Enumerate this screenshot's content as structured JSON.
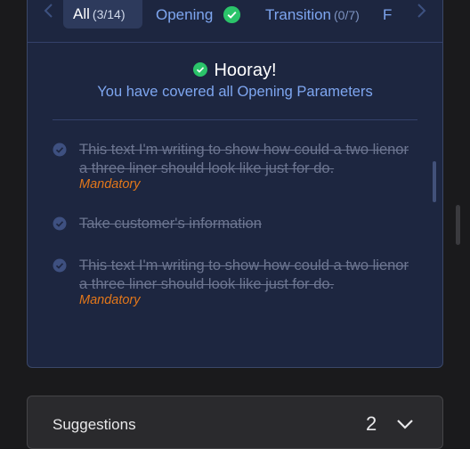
{
  "tabs": {
    "all": {
      "label": "All",
      "count": "(3/14)"
    },
    "opening": {
      "label": "Opening"
    },
    "transition": {
      "label": "Transition",
      "count": "(0/7)"
    },
    "extra": {
      "label": "F"
    }
  },
  "banner": {
    "title": "Hooray!",
    "subtitle": "You have covered all Opening Parameters"
  },
  "items": [
    {
      "text": "This text I'm writing to show how could a two lienor a three liner should look like just for do.",
      "tag": "Mandatory"
    },
    {
      "text": "Take customer's information"
    },
    {
      "text": "This text I'm writing to show how could a two lienor a three liner should look like just for do.",
      "tag": "Mandatory"
    }
  ],
  "suggestions": {
    "title": "Suggestions",
    "count": "2"
  },
  "colors": {
    "accent": "#7ea6f0",
    "success": "#2bc46a",
    "mandatory": "#e3771a",
    "panel": "#1d2640"
  }
}
